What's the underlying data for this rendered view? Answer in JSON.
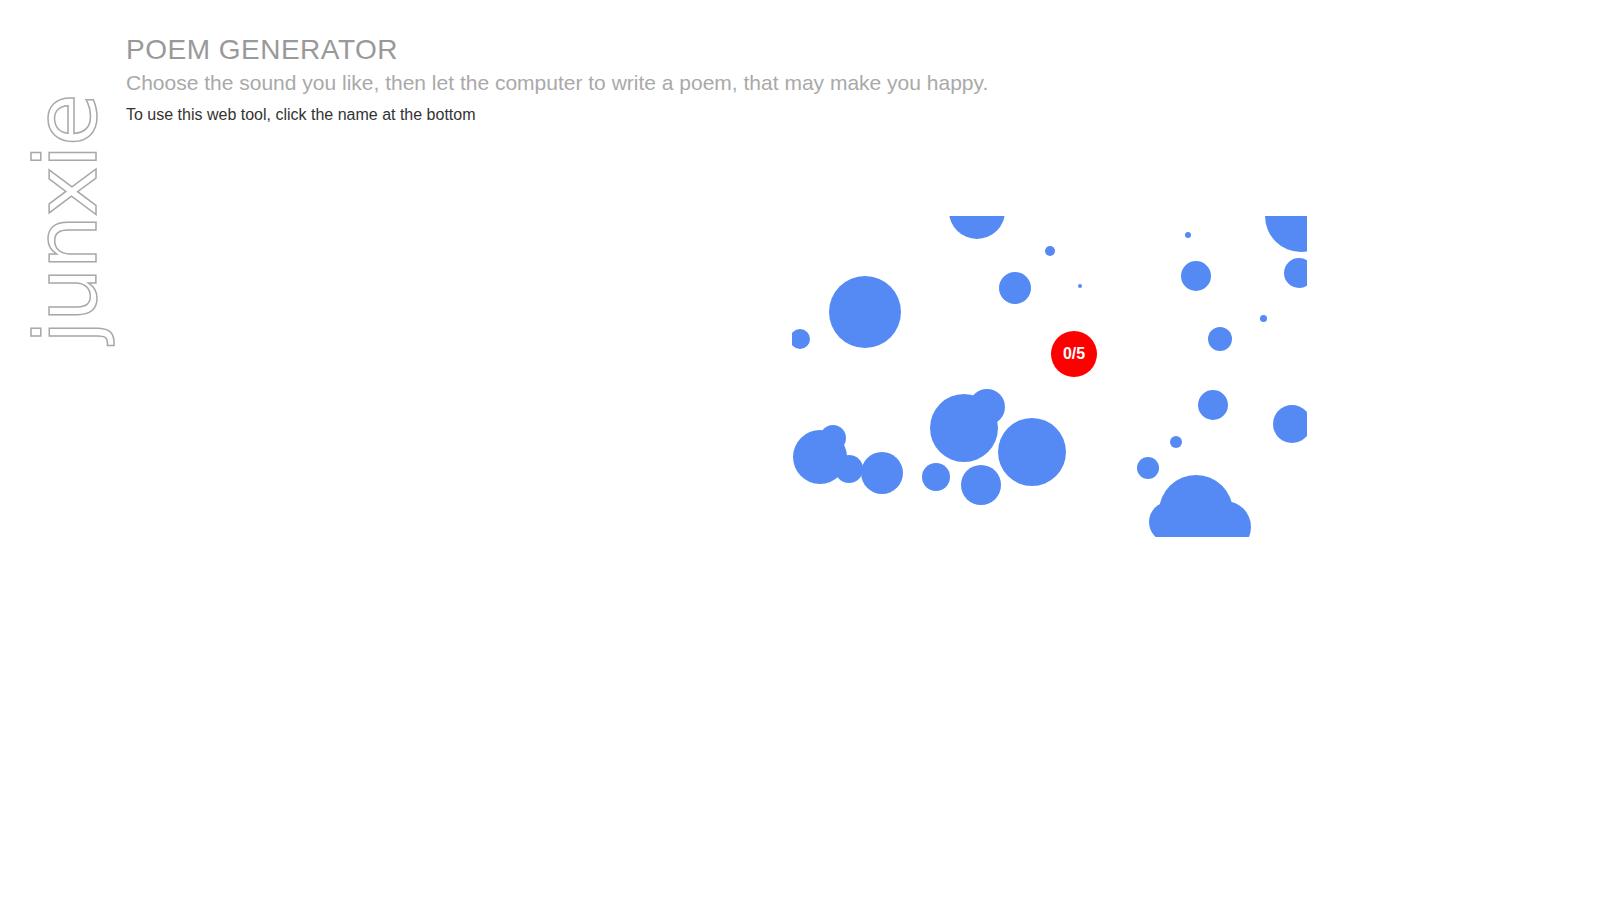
{
  "logo": {
    "text": "junxie"
  },
  "header": {
    "title": "POEM GENERATOR",
    "subtitle": "Choose the sound you like, then let the computer to write a poem, that may make you happy.",
    "instruction": "To use this web tool, click the name at the bottom"
  },
  "canvas": {
    "counter": "0/5"
  }
}
